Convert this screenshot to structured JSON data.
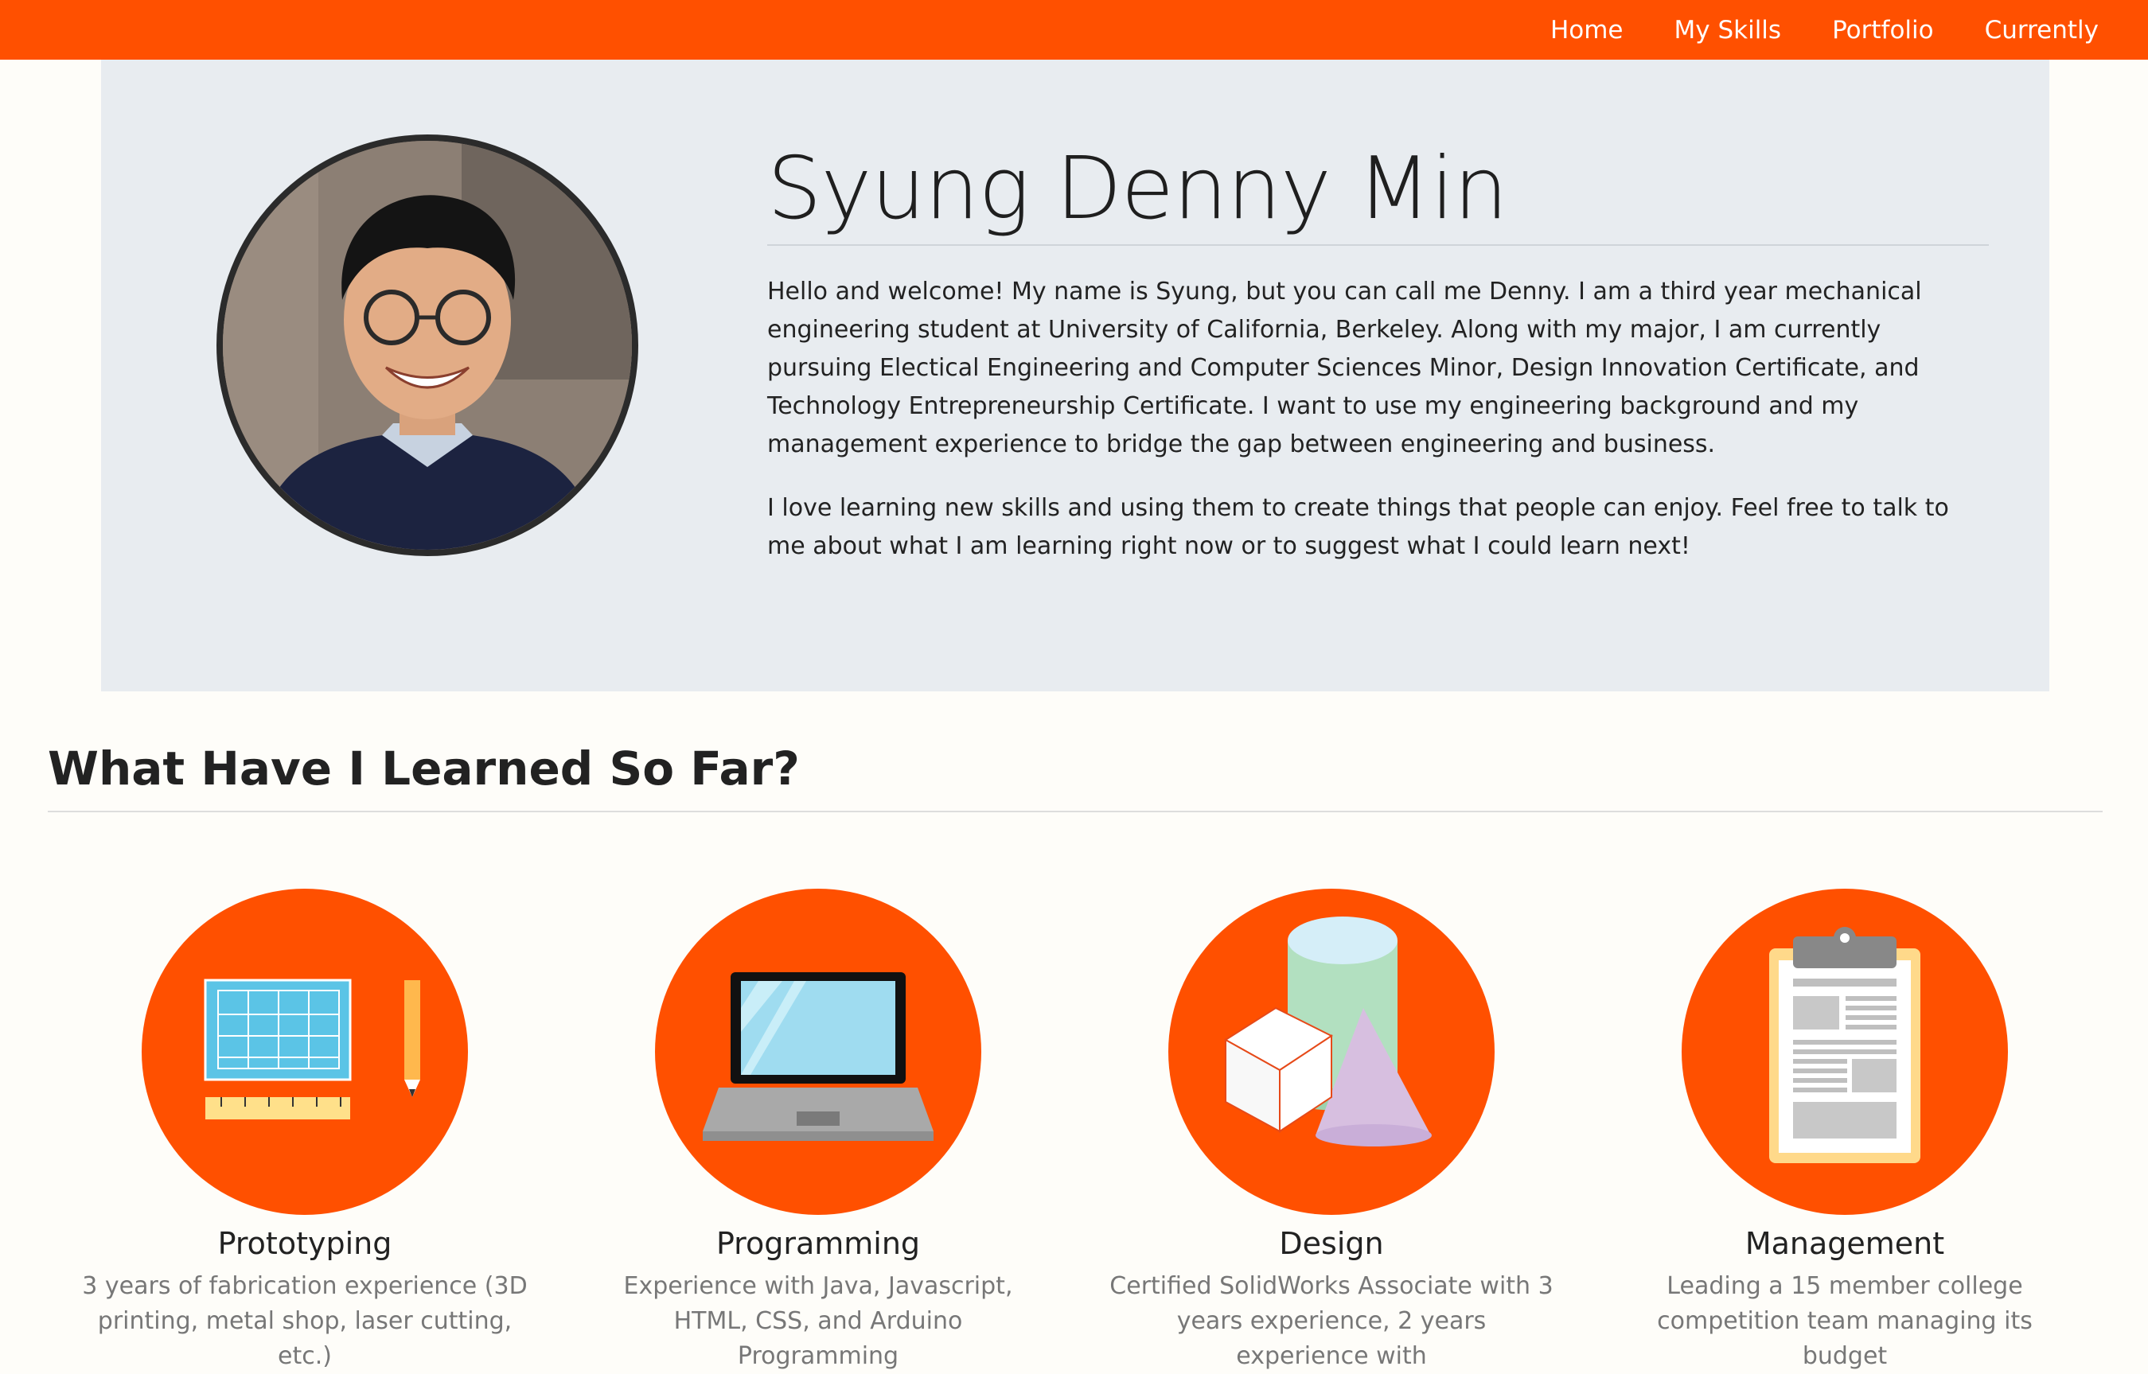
{
  "nav": {
    "items": [
      {
        "label": "Home"
      },
      {
        "label": "My Skills"
      },
      {
        "label": "Portfolio"
      },
      {
        "label": "Currently"
      }
    ]
  },
  "hero": {
    "name": "Syung Denny Min",
    "paragraph1": "Hello and welcome! My name is Syung, but you can call me Denny. I am a third year mechanical engineering student at University of California, Berkeley. Along with my major, I am currently pursuing Electical Engineering and Computer Sciences Minor, Design Innovation Certificate, and Technology Entrepreneurship Certificate. I want to use my engineering background and my management experience to bridge the gap between engineering and business.",
    "paragraph2": "I love learning new skills and using them to create things that people can enjoy. Feel free to talk to me about what I am learning right now or to suggest what I could learn next!"
  },
  "section": {
    "title": "What Have I Learned So Far?"
  },
  "skills": [
    {
      "name": "Prototyping",
      "icon": "blueprint-icon",
      "desc": "3 years of fabrication experience (3D printing, metal shop, laser cutting, etc.)"
    },
    {
      "name": "Programming",
      "icon": "laptop-icon",
      "desc": "Experience with Java, Javascript, HTML, CSS, and Arduino Programming"
    },
    {
      "name": "Design",
      "icon": "3d-shapes-icon",
      "desc": "Certified SolidWorks Associate with 3 years experience, 2 years experience with"
    },
    {
      "name": "Management",
      "icon": "clipboard-icon",
      "desc": "Leading a 15 member college competition team managing its budget"
    }
  ],
  "colors": {
    "accent": "#ff5000",
    "hero_bg": "#e8ecf0",
    "page_bg": "#fefdf9"
  }
}
